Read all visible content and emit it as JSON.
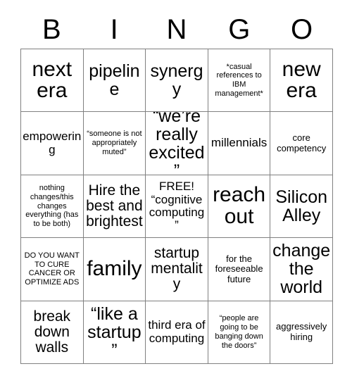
{
  "card": {
    "title_letters": [
      "B",
      "I",
      "N",
      "G",
      "O"
    ],
    "grid": {
      "rows": 5,
      "columns": 5,
      "border_color": "#808080",
      "background": "#ffffff",
      "text_color": "#000000"
    },
    "cells": [
      {
        "text": "next era",
        "size": "xxl"
      },
      {
        "text": "pipeline",
        "size": "xl"
      },
      {
        "text": "synergy",
        "size": "xl"
      },
      {
        "text": "*casual references to IBM management*",
        "size": "xs"
      },
      {
        "text": "new era",
        "size": "xxl"
      },
      {
        "text": "empowering",
        "size": "md"
      },
      {
        "text": "“someone is not appropriately muted”",
        "size": "xs"
      },
      {
        "text": "“we’re really excited”",
        "size": "xl"
      },
      {
        "text": "millennials",
        "size": "md"
      },
      {
        "text": "core competency",
        "size": "sm"
      },
      {
        "text": "nothing changes/this changes everything (has to be both)",
        "size": "xs"
      },
      {
        "text": "Hire the best and brightest",
        "size": "lg"
      },
      {
        "text": "FREE! “cognitive computing”",
        "size": "md"
      },
      {
        "text": "reach out",
        "size": "xxl"
      },
      {
        "text": "Silicon Alley",
        "size": "xl"
      },
      {
        "text": "DO YOU WANT TO CURE CANCER OR OPTIMIZE ADS",
        "size": "xs"
      },
      {
        "text": "family",
        "size": "xxl"
      },
      {
        "text": "startup mentality",
        "size": "lg"
      },
      {
        "text": "for the foreseeable future",
        "size": "sm"
      },
      {
        "text": "change the world",
        "size": "xl"
      },
      {
        "text": "break down walls",
        "size": "lg"
      },
      {
        "text": "“like a startup”",
        "size": "xl"
      },
      {
        "text": "third era of computing",
        "size": "md"
      },
      {
        "text": "“people are going to be banging down the doors”",
        "size": "xs"
      },
      {
        "text": "aggressively hiring",
        "size": "sm"
      }
    ]
  }
}
